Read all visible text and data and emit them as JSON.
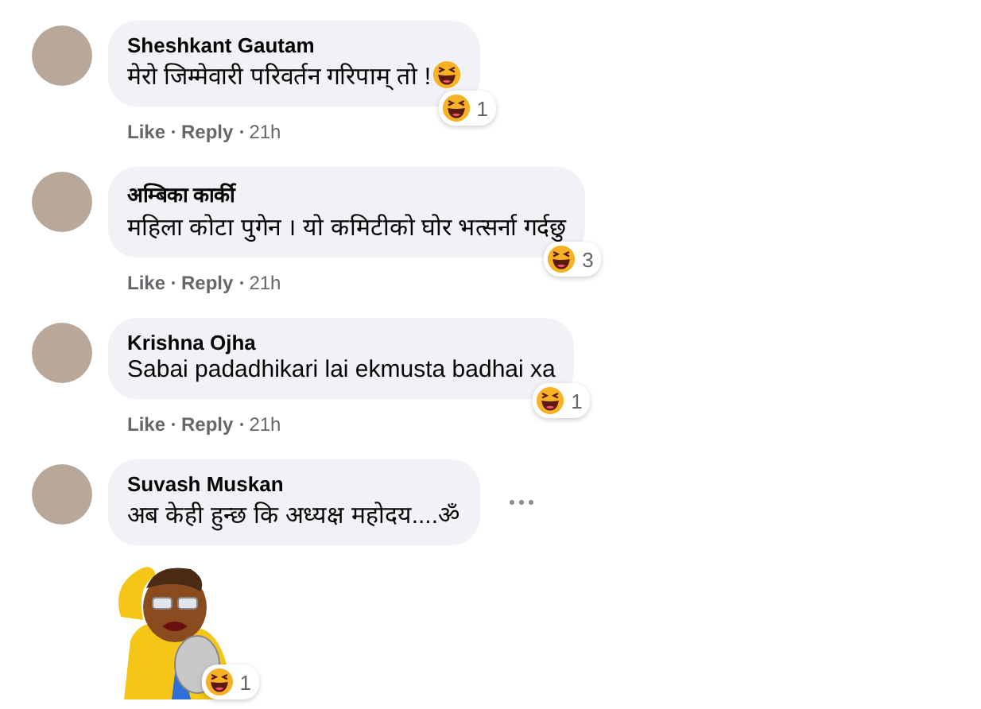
{
  "comments": [
    {
      "author": "Sheshkant Gautam",
      "text": "मेरो जिम्मेवारी परिवर्तन गरिपाम् तो !",
      "has_emoji": true,
      "reaction": {
        "count": "1"
      },
      "actions": {
        "like": "Like",
        "reply": "Reply",
        "time": "21h"
      },
      "more_button": false
    },
    {
      "author": "अम्बिका कार्की",
      "text": "महिला कोटा पुगेन । यो कमिटीको घोर भत्सर्ना गर्दछु",
      "has_emoji": false,
      "reaction": {
        "count": "3"
      },
      "actions": {
        "like": "Like",
        "reply": "Reply",
        "time": "21h"
      },
      "more_button": false
    },
    {
      "author": "Krishna Ojha",
      "text": "Sabai padadhikari lai ekmusta badhai xa",
      "has_emoji": false,
      "reaction": {
        "count": "1"
      },
      "actions": {
        "like": "Like",
        "reply": "Reply",
        "time": "21h"
      },
      "more_button": false
    },
    {
      "author": "Suvash Muskan",
      "text": "अब केही हुन्छ कि अध्यक्ष महोदय....ॐ",
      "has_emoji": false,
      "more_button": true,
      "sticker": {
        "reaction": {
          "count": "1"
        }
      }
    }
  ]
}
